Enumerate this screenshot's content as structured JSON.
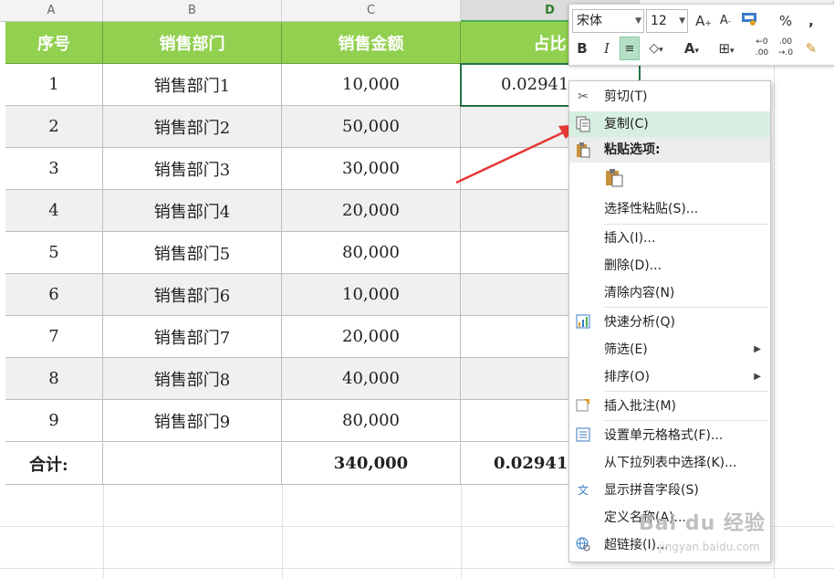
{
  "columns": [
    "A",
    "B",
    "C",
    "D"
  ],
  "table": {
    "headers": [
      "序号",
      "销售部门",
      "销售金额",
      "占比"
    ],
    "rows": [
      [
        "1",
        "销售部门1",
        "10,000",
        "0.02941"
      ],
      [
        "2",
        "销售部门2",
        "50,000",
        ""
      ],
      [
        "3",
        "销售部门3",
        "30,000",
        ""
      ],
      [
        "4",
        "销售部门4",
        "20,000",
        ""
      ],
      [
        "5",
        "销售部门5",
        "80,000",
        ""
      ],
      [
        "6",
        "销售部门6",
        "10,000",
        ""
      ],
      [
        "7",
        "销售部门7",
        "20,000",
        ""
      ],
      [
        "8",
        "销售部门8",
        "40,000",
        ""
      ],
      [
        "9",
        "销售部门9",
        "80,000",
        ""
      ]
    ],
    "total": [
      "合计:",
      "",
      "340,000",
      "0.02941"
    ]
  },
  "mini_toolbar": {
    "font_name": "宋体",
    "font_size": "12",
    "percent": "%",
    "comma": ","
  },
  "context_menu": {
    "items": [
      {
        "label": "剪切(T)",
        "icon": "scissors-icon"
      },
      {
        "label": "复制(C)",
        "icon": "copy-icon"
      },
      {
        "label": "粘贴选项:",
        "icon": "paste-icon"
      },
      {
        "label": "选择性粘贴(S)..."
      },
      {
        "label": "插入(I)..."
      },
      {
        "label": "删除(D)..."
      },
      {
        "label": "清除内容(N)"
      },
      {
        "label": "快速分析(Q)",
        "icon": "quick-analysis-icon"
      },
      {
        "label": "筛选(E)"
      },
      {
        "label": "排序(O)"
      },
      {
        "label": "插入批注(M)",
        "icon": "comment-icon"
      },
      {
        "label": "设置单元格格式(F)...",
        "icon": "format-cells-icon"
      },
      {
        "label": "从下拉列表中选择(K)..."
      },
      {
        "label": "显示拼音字段(S)",
        "icon": "pinyin-icon"
      },
      {
        "label": "定义名称(A)..."
      },
      {
        "label": "超链接(I)...",
        "icon": "hyperlink-icon"
      }
    ]
  },
  "colors": {
    "header_green": "#92d050",
    "highlight": "#d7efe0",
    "arrow_red": "#e53935"
  },
  "watermark": {
    "brand": "Bai du 经验",
    "url": "jingyan.baidu.com"
  }
}
